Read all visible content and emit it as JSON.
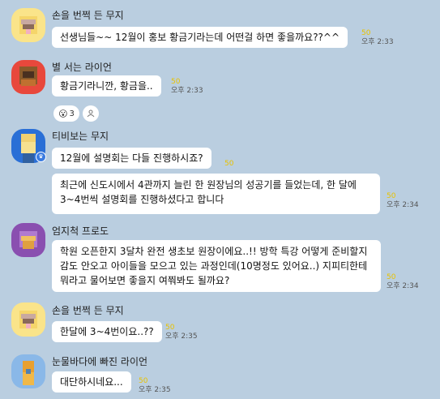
{
  "messages": [
    {
      "sender": "손을 번쩍 든 무지",
      "text": "선생님들~~ 12월이 홍보 황금기라는데 어떤걸 하면 좋을까요??^^",
      "count": "50",
      "time": "오후 2:33"
    },
    {
      "sender": "별 서는 라이언",
      "text": "황금기라니깐, 황금을..",
      "count": "50",
      "time": "오후 2:33",
      "reaction": {
        "emoji": "😮",
        "count": "3"
      }
    },
    {
      "sender": "티비보는 무지",
      "text1": "12월에 설명회는 다들 진행하시죠?",
      "count1": "50",
      "text2": "최근에 신도시에서 4관까지 늘린 한 원장님의 성공기를 들었는데, 한 달에 3~4번씩 설명회를 진행하셨다고 합니다",
      "count2": "50",
      "time2": "오후 2:34"
    },
    {
      "sender": "엄지척 프로도",
      "text": "학원 오픈한지 3달차 완전 생초보 원장이에요..!! 방학 특강 어떻게 준비할지 감도 안오고 아이들을 모으고 있는 과정인데(10명정도 있어요..) 지피티한테 뭐라고 물어보면 좋을지 여쭤봐도 될까요?",
      "count": "50",
      "time": "오후 2:34"
    },
    {
      "sender": "손을 번쩍 든 무지",
      "text": "한달에 3~4번이요..??",
      "count": "50",
      "time": "오후 2:35"
    },
    {
      "sender": "눈물바다에 빠진 라이언",
      "text": "대단하시네요...",
      "count": "50",
      "time": "오후 2:35"
    }
  ],
  "colors": {
    "background": "#bacee0",
    "bubble": "#ffffff",
    "unread": "#e8c200"
  }
}
